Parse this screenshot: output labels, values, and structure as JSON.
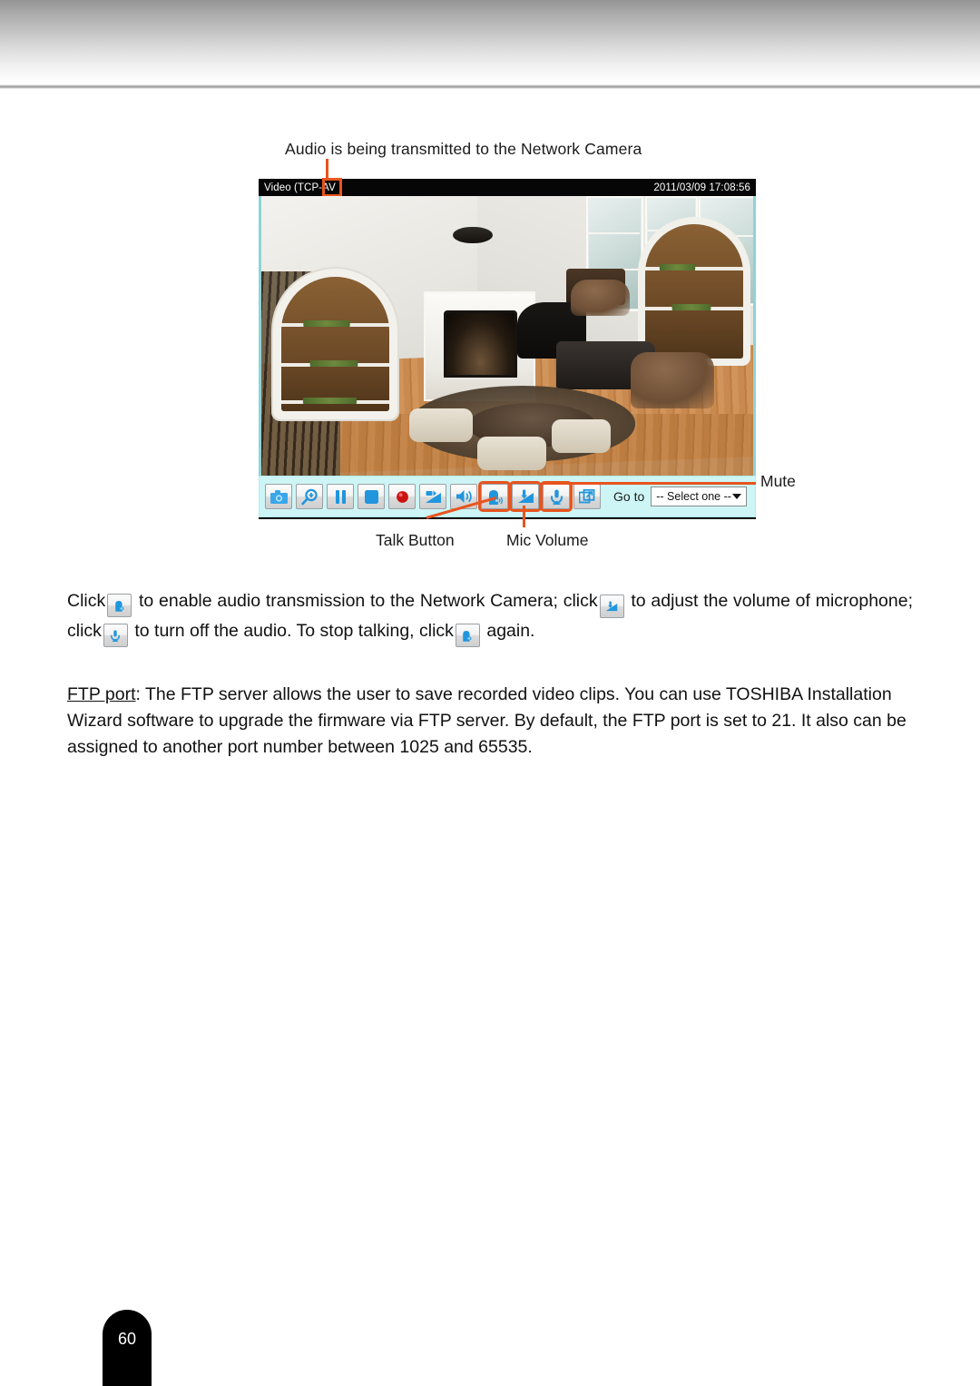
{
  "page": {
    "number": "60"
  },
  "figure": {
    "top_callout": "Audio is being transmitted to the Network Camera",
    "player": {
      "title": "Video (TCP-AV",
      "title_highlight": "AV",
      "timestamp": "2011/03/09  17:08:56",
      "scene_description": "living-room-surveillance-view"
    },
    "toolbar": {
      "buttons": [
        {
          "name": "snapshot-button",
          "icon": "camera-icon",
          "label": "Snapshot",
          "highlighted": false
        },
        {
          "name": "digital-zoom-button",
          "icon": "magnifier-plus-icon",
          "label": "Digital Zoom",
          "highlighted": false
        },
        {
          "name": "pause-button",
          "icon": "pause-icon",
          "label": "Pause",
          "highlighted": false
        },
        {
          "name": "stop-button",
          "icon": "stop-square-icon",
          "label": "Stop",
          "highlighted": false
        },
        {
          "name": "record-button",
          "icon": "record-red-dot-icon",
          "label": "Start MP4 Recording",
          "highlighted": false
        },
        {
          "name": "speaker-volume-button",
          "icon": "volume-slider-icon",
          "label": "Volume",
          "highlighted": false
        },
        {
          "name": "mute-speaker-button",
          "icon": "speaker-icon",
          "label": "Mute",
          "highlighted": false
        },
        {
          "name": "talk-button",
          "icon": "talk-head-icon",
          "label": "Talk",
          "highlighted": true
        },
        {
          "name": "mic-volume-button",
          "icon": "mic-volume-slider-icon",
          "label": "Mic Volume",
          "highlighted": true
        },
        {
          "name": "microphone-mute-button",
          "icon": "microphone-icon",
          "label": "Mute Microphone",
          "highlighted": true
        },
        {
          "name": "fullscreen-button",
          "icon": "expand-fullscreen-icon",
          "label": "Full Screen",
          "highlighted": false
        }
      ],
      "goto_label": "Go to",
      "goto_selected": "-- Select one --"
    },
    "callouts": {
      "mute": "Mute",
      "talk_button": "Talk Button",
      "mic_volume": "Mic Volume"
    }
  },
  "content": {
    "audio_paragraph": {
      "seg1": "Click",
      "seg2": "to enable audio transmission to the Network Camera; click",
      "seg3": "to adjust the volume of microphone; click",
      "seg4": "to turn off the audio. To stop talking, click",
      "seg5": "again."
    },
    "ftp_paragraph": {
      "term": "FTP port",
      "text": ": The FTP server allows the user to save recorded video clips. You can use TOSHIBA Installation Wizard software to upgrade the firmware via FTP server. By default, the FTP port is set to 21. It also can be assigned to another port number between 1025 and 65535."
    }
  },
  "colors": {
    "accent_orange": "#e8541e",
    "toolbar_bg": "#cdf5f5",
    "icon_blue": "#2196dd",
    "record_red": "#cc1111"
  }
}
